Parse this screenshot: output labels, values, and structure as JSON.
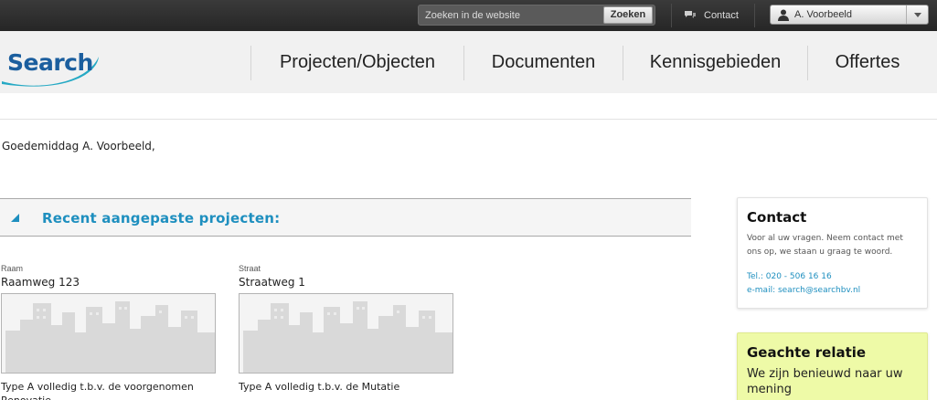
{
  "topbar": {
    "search_placeholder": "Zoeken in de website",
    "search_button": "Zoeken",
    "contact_label": "Contact",
    "user_name": "A. Voorbeeld"
  },
  "header": {
    "logo_text": "Search",
    "nav": [
      "Projecten/Objecten",
      "Documenten",
      "Kennisgebieden",
      "Offertes"
    ]
  },
  "main": {
    "greeting": "Goedemiddag A. Voorbeeld,",
    "section_title": "Recent aangepaste projecten:",
    "projects": [
      {
        "category": "Raam",
        "title": "Raamweg 123",
        "description": "Type A volledig t.b.v. de voorgenomen Renovatie"
      },
      {
        "category": "Straat",
        "title": "Straatweg 1",
        "description": "Type A volledig t.b.v. de Mutatie"
      }
    ]
  },
  "sidebar": {
    "contact": {
      "title": "Contact",
      "text": "Voor al uw vragen. Neem contact met ons op, we staan u graag te woord.",
      "phone": "Tel.: 020 - 506 16 16",
      "email": "e-mail: search@searchbv.nl"
    },
    "relatie": {
      "title": "Geachte relatie",
      "text": "We zijn benieuwd naar uw mening"
    }
  },
  "colors": {
    "accent": "#1e8fbf",
    "logo_blue": "#1b5e9e",
    "relatie_bg": "#eefaa7",
    "topbar_bg": "#2b2b2b"
  },
  "icons": [
    "chat-icon",
    "user-icon",
    "chevron-down-icon",
    "collapse-arrow-icon"
  ]
}
